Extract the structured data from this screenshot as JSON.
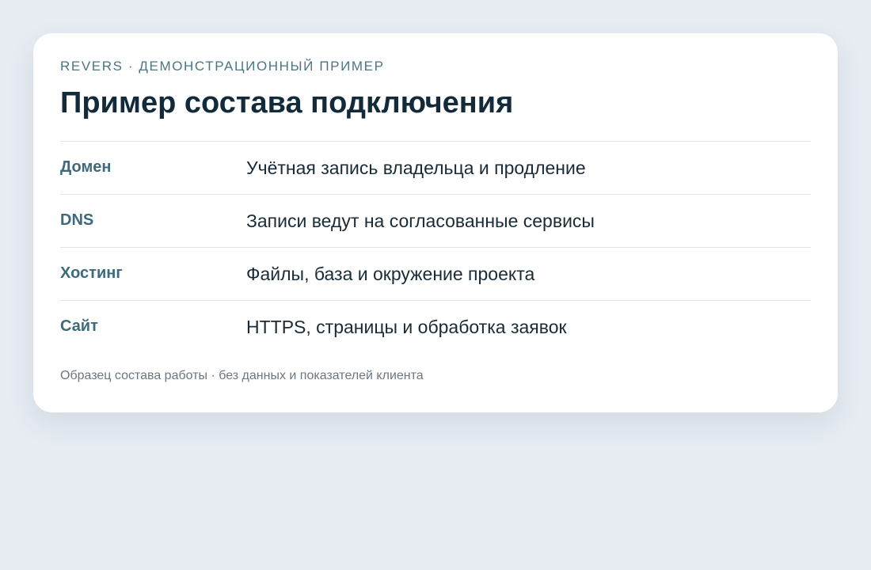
{
  "header": {
    "eyebrow": "REVERS · ДЕМОНСТРАЦИОННЫЙ ПРИМЕР",
    "title": "Пример состава подключения"
  },
  "rows": [
    {
      "label": "Домен",
      "value": "Учётная запись владельца и продление"
    },
    {
      "label": "DNS",
      "value": "Записи ведут на согласованные сервисы"
    },
    {
      "label": "Хостинг",
      "value": "Файлы, база и окружение проекта"
    },
    {
      "label": "Сайт",
      "value": "HTTPS, страницы и обработка заявок"
    }
  ],
  "footnote": "Образец состава работы · без данных и показателей клиента",
  "colors": {
    "background": "#e7ecf3",
    "card": "#ffffff",
    "title": "#132a3a",
    "accent_label": "#3d6b7b",
    "eyebrow": "#4a7584",
    "muted": "#6b7780"
  }
}
